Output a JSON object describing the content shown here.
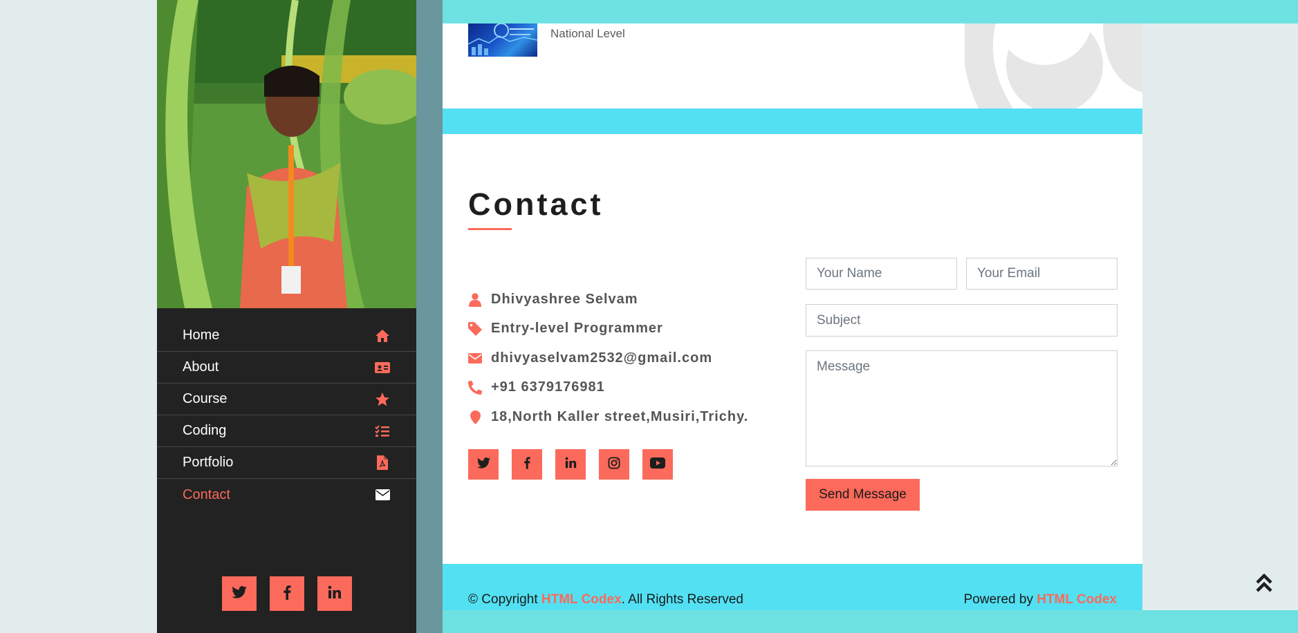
{
  "colors": {
    "accent": "#fb6a5b",
    "sidebar": "#222222",
    "cyan_band": "#52e0f2",
    "teal_band": "#6ee2e2"
  },
  "sidebar": {
    "nav": [
      {
        "label": "Home",
        "icon": "home-icon",
        "active": false
      },
      {
        "label": "About",
        "icon": "id-card-icon",
        "active": false
      },
      {
        "label": "Course",
        "icon": "star-icon",
        "active": false
      },
      {
        "label": "Coding",
        "icon": "task-list-icon",
        "active": false
      },
      {
        "label": "Portfolio",
        "icon": "pdf-file-icon",
        "active": false
      },
      {
        "label": "Contact",
        "icon": "envelope-icon",
        "active": true
      }
    ],
    "social": [
      "twitter-icon",
      "facebook-icon",
      "linkedin-icon"
    ]
  },
  "portfolio": {
    "level": "National Level"
  },
  "contact": {
    "title": "Contact",
    "info": {
      "name": "Dhivyashree Selvam",
      "role": "Entry-level Programmer",
      "email": "dhivyaselvam2532@gmail.com",
      "phone": "+91 6379176981",
      "address": "18,North Kaller street,Musiri,Trichy."
    },
    "social": [
      "twitter-icon",
      "facebook-icon",
      "linkedin-icon",
      "instagram-icon",
      "youtube-icon"
    ],
    "form": {
      "name_placeholder": "Your Name",
      "email_placeholder": "Your Email",
      "subject_placeholder": "Subject",
      "message_placeholder": "Message",
      "send_label": "Send Message"
    }
  },
  "footer": {
    "copyright_prefix": "© Copyright ",
    "brand": "HTML Codex",
    "copyright_suffix": ". All Rights Reserved",
    "powered_prefix": "Powered by "
  }
}
